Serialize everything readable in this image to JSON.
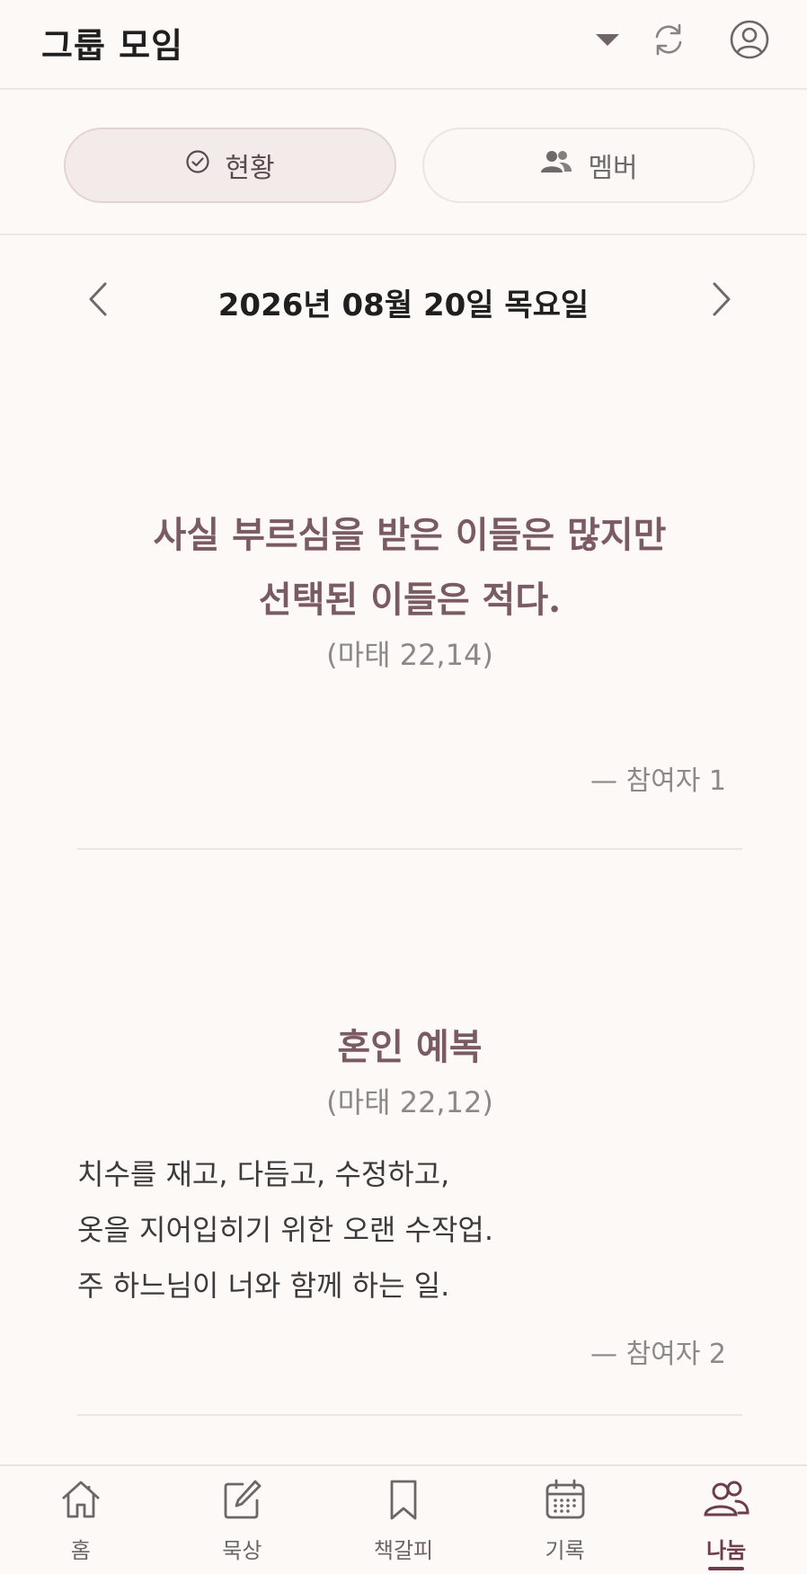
{
  "header": {
    "title": "그룹 모임",
    "icons": [
      "dropdown-caret-icon",
      "refresh-icon",
      "profile-icon"
    ]
  },
  "tabs": [
    {
      "label": "현황",
      "icon": "check-circle-icon",
      "selected": true
    },
    {
      "label": "멤버",
      "icon": "members-icon",
      "selected": false
    }
  ],
  "date": {
    "text": "2026년 08월 20일 목요일"
  },
  "posts": [
    {
      "title_line1": "사실 부르심을 받은 이들은 많지만",
      "title_line2": "선택된 이들은 적다.",
      "reference": "(마태 22,14)",
      "author": "— 참여자 1"
    },
    {
      "title": "혼인 예복",
      "reference": "(마태 22,12)",
      "body": [
        "치수를 재고, 다듬고, 수정하고,",
        "옷을 지어입히기 위한 오랜 수작업.",
        "주 하느님이 너와 함께 하는 일."
      ],
      "author": "— 참여자 2"
    }
  ],
  "nav": [
    {
      "label": "홈",
      "icon": "home-icon"
    },
    {
      "label": "묵상",
      "icon": "edit-icon"
    },
    {
      "label": "책갈피",
      "icon": "bookmark-icon"
    },
    {
      "label": "기록",
      "icon": "calendar-icon"
    },
    {
      "label": "나눔",
      "icon": "group-icon",
      "active": true
    }
  ],
  "colors": {
    "accent": "#6d3d4b",
    "title_text": "#7a5a63",
    "background": "#fcf9f7"
  }
}
